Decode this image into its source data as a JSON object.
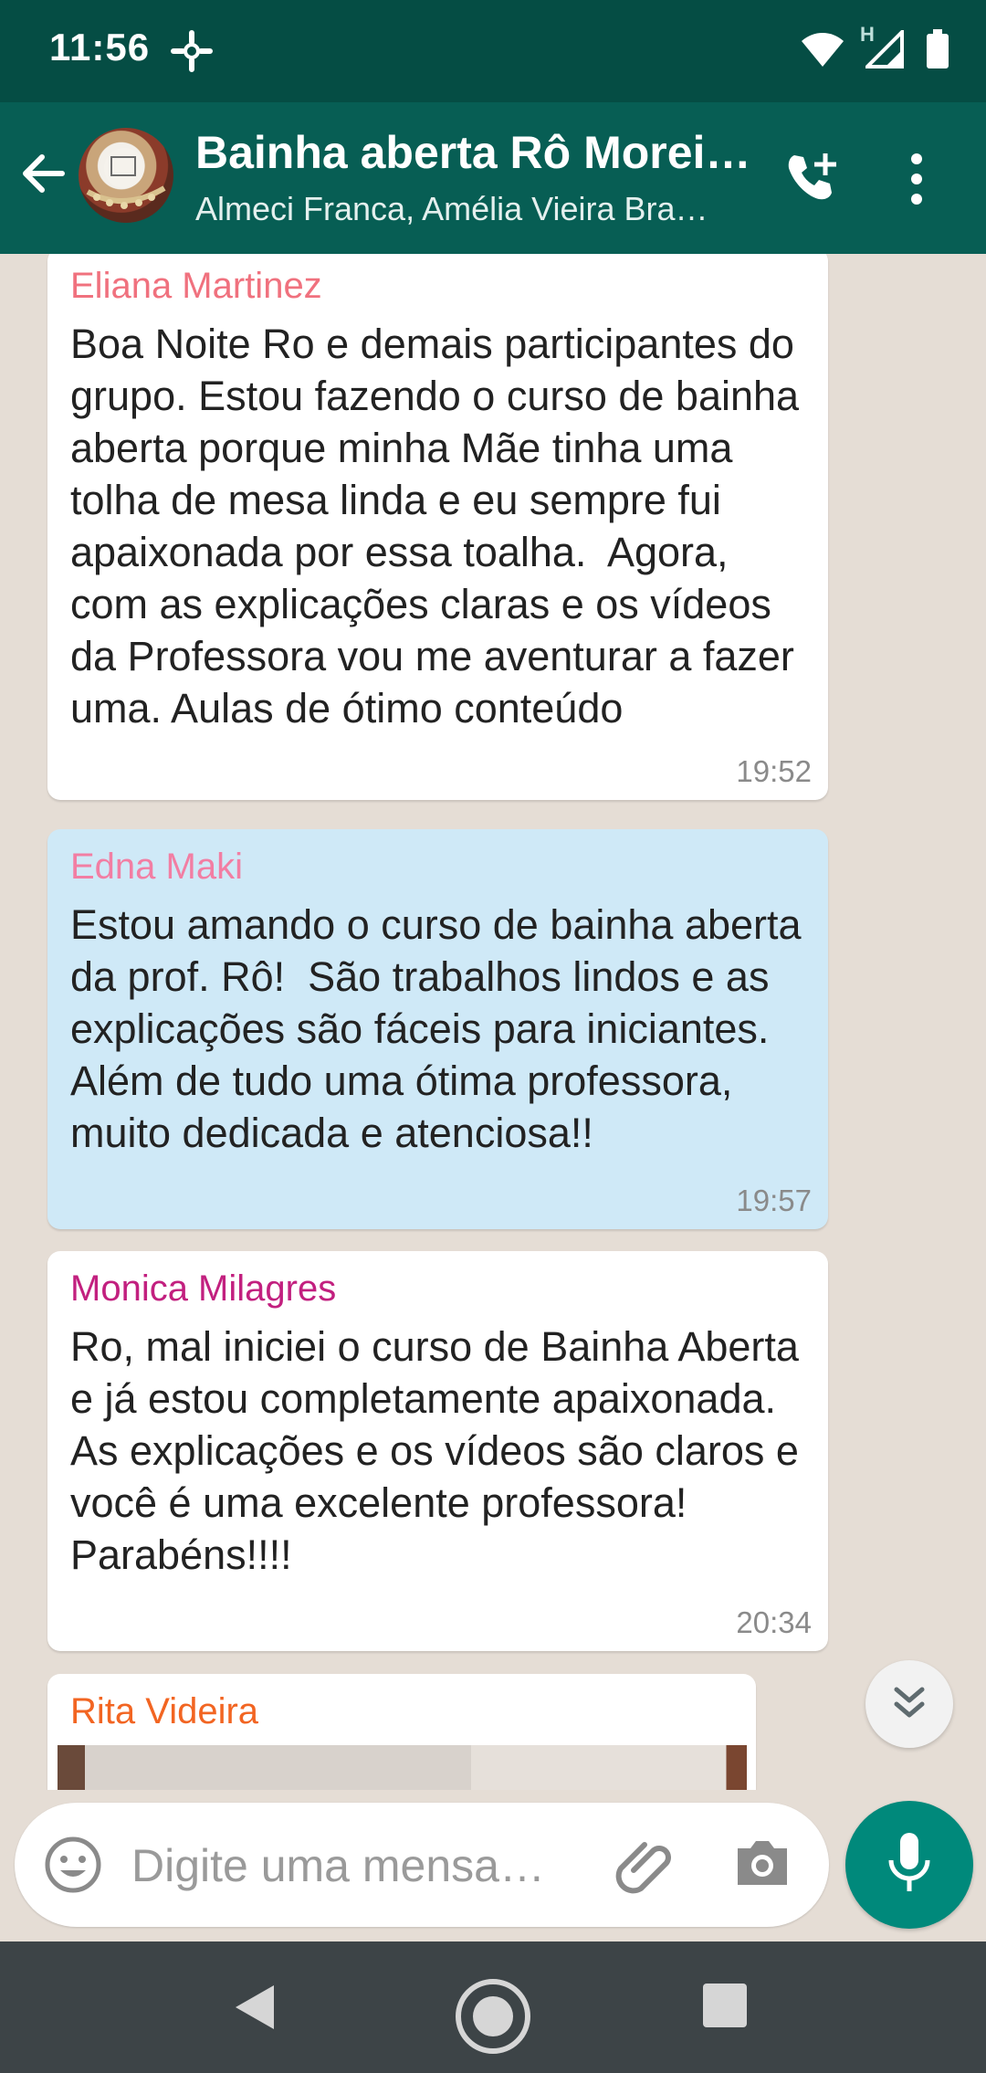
{
  "status_bar": {
    "time": "11:56",
    "network_label": "H"
  },
  "header": {
    "title": "Bainha aberta Rô Morei…",
    "subtitle": "Almeci Franca, Amélia Vieira Bra…"
  },
  "messages": [
    {
      "sender": "Eliana Martinez",
      "sender_color": "#f0717e",
      "text": "Boa Noite Ro e demais participantes do grupo. Estou fazendo o curso de bainha aberta porque minha Mãe tinha uma tolha de mesa linda e eu sempre fui apaixonada por essa toalha.  Agora, com as explicações claras e os vídeos da Professora vou me aventurar a fazer uma. Aulas de ótimo conteúdo",
      "time": "19:52"
    },
    {
      "sender": "Edna Maki",
      "sender_color": "#f27ea3",
      "text": "Estou amando o curso de bainha aberta da prof. Rô!  São trabalhos lindos e as explicações são fáceis para iniciantes. Além de tudo uma ótima professora, muito dedicada e atenciosa!!",
      "time": "19:57"
    },
    {
      "sender": "Monica Milagres",
      "sender_color": "#c2207f",
      "text": "Ro, mal iniciei o curso de Bainha Aberta e já estou completamente apaixonada.\nAs explicações e os vídeos são claros e você é uma excelente professora! Parabéns!!!!",
      "time": "20:34"
    },
    {
      "sender": "Rita Videira",
      "sender_color": "#f26522"
    }
  ],
  "composer": {
    "placeholder": "Digite uma mensa…"
  },
  "colors": {
    "header": "#075e54",
    "status_bar": "#054d44",
    "chat_background": "#e5ddd5",
    "mic_button": "#00897b",
    "highlight_bubble": "#cfe9f7"
  },
  "icons": [
    "settings-notification-icon",
    "wifi-icon",
    "signal-icon",
    "battery-icon",
    "back-arrow-icon",
    "add-call-icon",
    "more-options-icon",
    "scroll-down-icon",
    "emoji-icon",
    "attach-icon",
    "camera-icon",
    "mic-icon",
    "nav-back-icon",
    "nav-home-icon",
    "nav-recents-icon"
  ]
}
